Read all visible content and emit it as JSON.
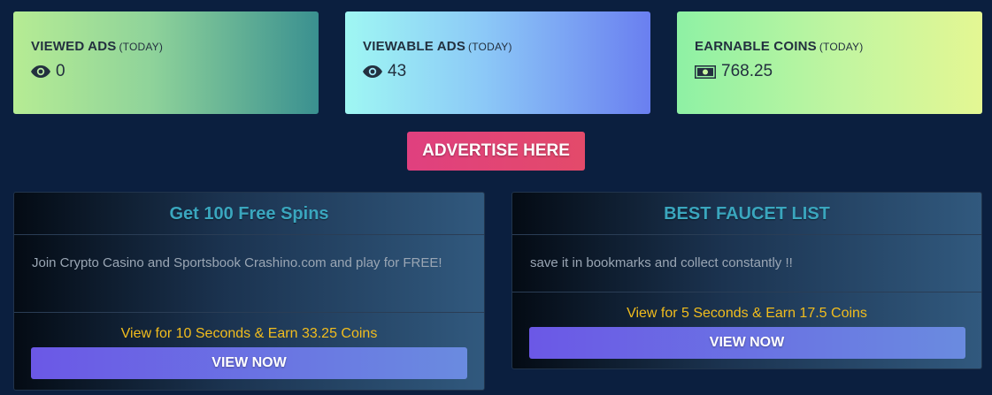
{
  "stats": [
    {
      "title": "VIEWED ADS",
      "sub": "(TODAY)",
      "icon": "eye-icon",
      "value": "0"
    },
    {
      "title": "VIEWABLE ADS",
      "sub": "(TODAY)",
      "icon": "eye-icon",
      "value": "43"
    },
    {
      "title": "EARNABLE COINS",
      "sub": "(TODAY)",
      "icon": "money-bill-icon",
      "value": "768.25"
    }
  ],
  "advertise": {
    "label": "ADVERTISE HERE"
  },
  "ads": [
    {
      "title": "Get 100 Free Spins",
      "description": "Join Crypto Casino and Sportsbook Crashino.com and play for FREE!",
      "earn_text": "View for 10 Seconds & Earn 33.25 Coins",
      "button_label": "VIEW NOW"
    },
    {
      "title": "BEST FAUCET LIST",
      "description": "save it in bookmarks and collect constantly !!",
      "earn_text": "View for 5 Seconds & Earn 17.5 Coins",
      "button_label": "VIEW NOW"
    }
  ],
  "colors": {
    "background": "#0b1f3f",
    "accent_title": "#3aa6be",
    "earn_text": "#f2bd1d",
    "advertise_button": "#e0407f",
    "view_button": "#6b58e6"
  }
}
